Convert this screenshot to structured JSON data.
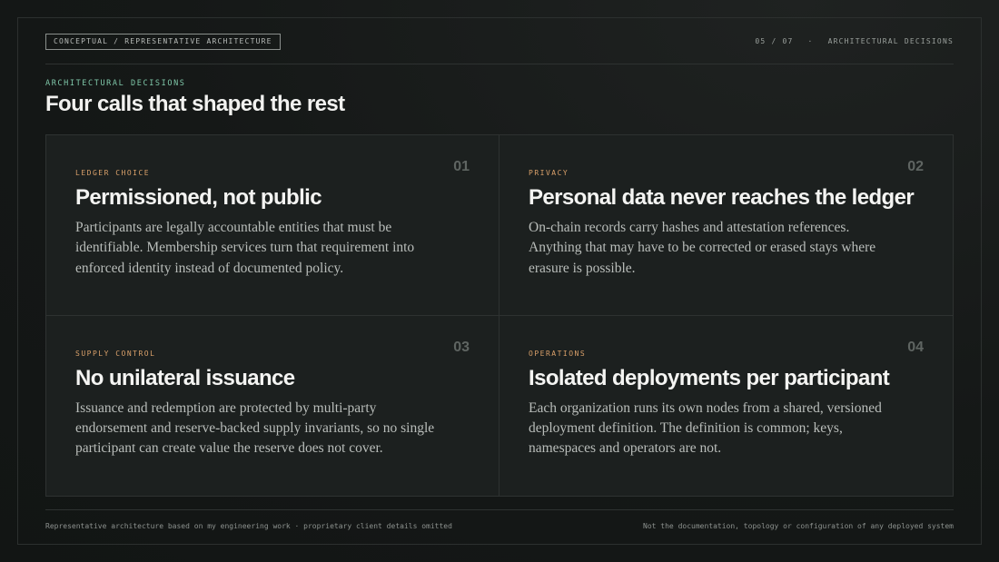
{
  "header": {
    "tag": "CONCEPTUAL / REPRESENTATIVE ARCHITECTURE",
    "page_indicator": "05 / 07",
    "separator": "·",
    "section_name": "ARCHITECTURAL DECISIONS"
  },
  "intro": {
    "kicker": "ARCHITECTURAL DECISIONS",
    "headline": "Four calls that shaped the rest"
  },
  "cards": [
    {
      "number": "01",
      "label": "LEDGER CHOICE",
      "title": "Permissioned, not public",
      "body": "Participants are legally accountable entities that must be identifiable. Membership services turn that requirement into enforced identity instead of documented policy."
    },
    {
      "number": "02",
      "label": "PRIVACY",
      "title": "Personal data never reaches the ledger",
      "body": "On-chain records carry hashes and attestation references. Anything that may have to be corrected or erased stays where erasure is possible."
    },
    {
      "number": "03",
      "label": "SUPPLY CONTROL",
      "title": "No unilateral issuance",
      "body": "Issuance and redemption are protected by multi-party endorsement and reserve-backed supply invariants, so no single participant can create value the reserve does not cover."
    },
    {
      "number": "04",
      "label": "OPERATIONS",
      "title": "Isolated deployments per participant",
      "body": "Each organization runs its own nodes from a shared, versioned deployment definition. The definition is common; keys, namespaces and operators are not."
    }
  ],
  "footer": {
    "left": "Representative architecture based on my engineering work · proprietary client details omitted",
    "right": "Not the documentation, topology or configuration of any deployed system"
  }
}
